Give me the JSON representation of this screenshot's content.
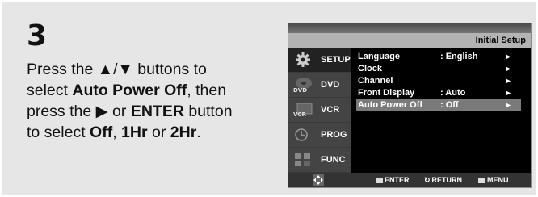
{
  "step": {
    "number": "3",
    "line1_pre": "Press the ▲/▼ buttons to",
    "line2_pre": "select ",
    "line2_bold": "Auto Power Off",
    "line2_post": ", then",
    "line3_pre": "press the ▶ or ",
    "line3_bold": "ENTER",
    "line3_post": " button",
    "line4_pre": "to select ",
    "opt1": "Off",
    "sep1": ", ",
    "opt2": "1Hr",
    "sep2": " or ",
    "opt3": "2Hr",
    "end": "."
  },
  "screen": {
    "title": "Initial Setup",
    "sidebar": [
      {
        "label": "SETUP",
        "icon": "gear-icon",
        "active": true
      },
      {
        "label": "DVD",
        "icon": "dvd-icon",
        "active": false
      },
      {
        "label": "VCR",
        "icon": "vcr-icon",
        "active": false
      },
      {
        "label": "PROG",
        "icon": "clock-icon",
        "active": false
      },
      {
        "label": "FUNC",
        "icon": "func-icon",
        "active": false
      }
    ],
    "menu": [
      {
        "name": "Language",
        "value": ": English",
        "arrow": "►"
      },
      {
        "name": "Clock",
        "value": "",
        "arrow": "►"
      },
      {
        "name": "Channel",
        "value": "",
        "arrow": "►"
      },
      {
        "name": "Front Display",
        "value": ": Auto",
        "arrow": "►"
      },
      {
        "name": "Auto Power Off",
        "value": ": Off",
        "arrow": "►",
        "selected": true
      }
    ],
    "hints": {
      "enter": "ENTER",
      "return": "RETURN",
      "menu": "MENU"
    }
  }
}
